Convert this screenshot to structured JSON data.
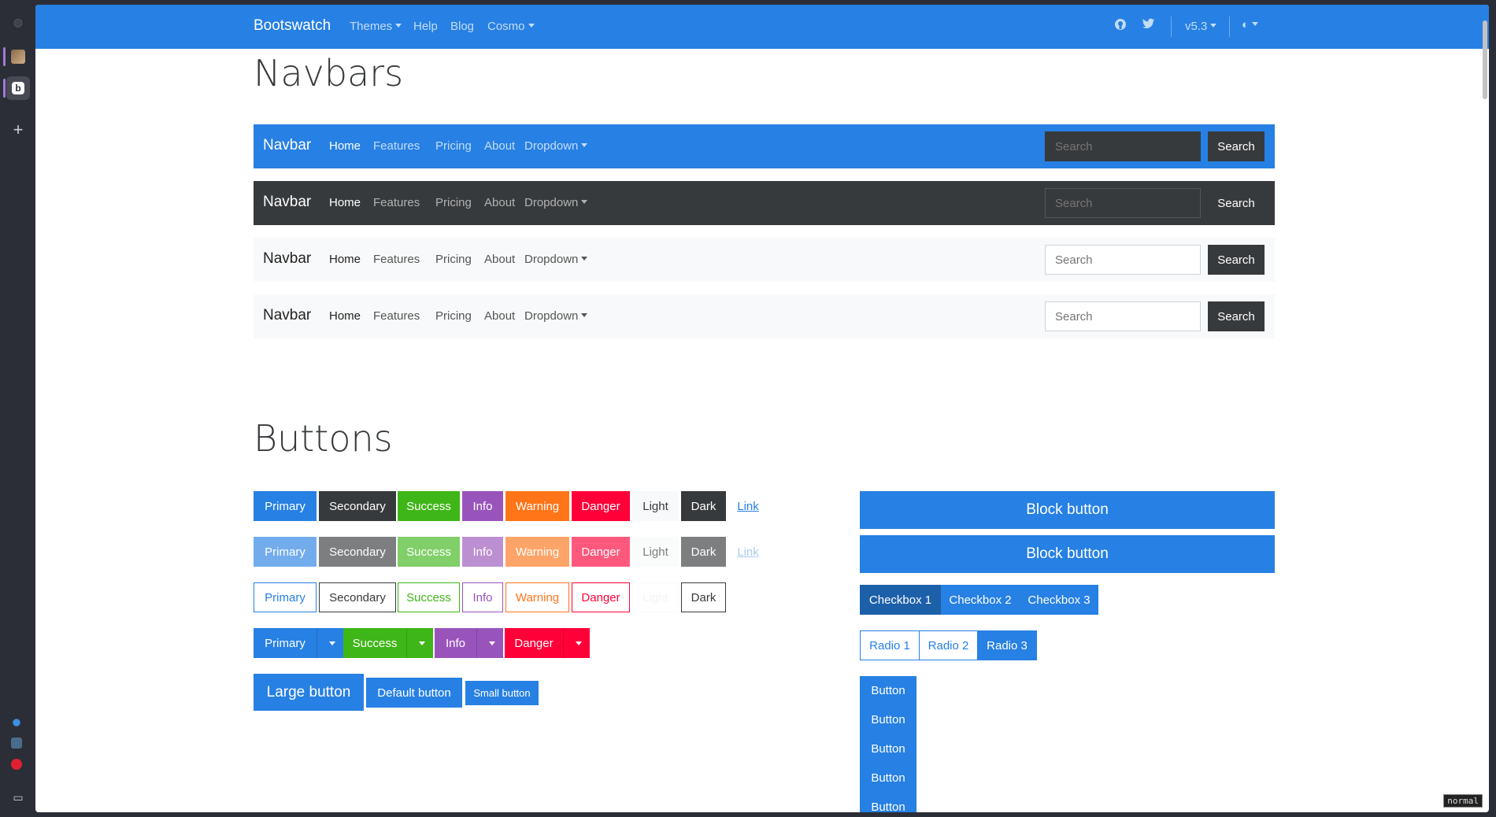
{
  "topnav": {
    "brand": "Bootswatch",
    "links": [
      "Themes",
      "Help",
      "Blog",
      "Cosmo"
    ],
    "version": "v5.3"
  },
  "sections": {
    "navbars_title": "Navbars",
    "buttons_title": "Buttons"
  },
  "example_navbar": {
    "brand": "Navbar",
    "links": [
      "Home",
      "Features",
      "Pricing",
      "About",
      "Dropdown"
    ],
    "search_placeholder": "Search",
    "search_button": "Search"
  },
  "button_labels": [
    "Primary",
    "Secondary",
    "Success",
    "Info",
    "Warning",
    "Danger",
    "Light",
    "Dark",
    "Link"
  ],
  "split_buttons": [
    "Primary",
    "Success",
    "Info",
    "Danger"
  ],
  "size_buttons": [
    "Large button",
    "Default button",
    "Small button"
  ],
  "block_buttons": [
    "Block button",
    "Block button"
  ],
  "checkbox_group": [
    "Checkbox 1",
    "Checkbox 2",
    "Checkbox 3"
  ],
  "radio_group": [
    "Radio 1",
    "Radio 2",
    "Radio 3"
  ],
  "vertical_buttons": [
    "Button",
    "Button",
    "Button",
    "Button",
    "Button"
  ],
  "mode_indicator": "normal",
  "colors": {
    "primary": "#2780e3",
    "secondary": "#373a3c",
    "success": "#3fb618",
    "info": "#9954bb",
    "warning": "#ff7518",
    "danger": "#ff0039",
    "light": "#f8f9fa",
    "dark": "#373a3c"
  }
}
